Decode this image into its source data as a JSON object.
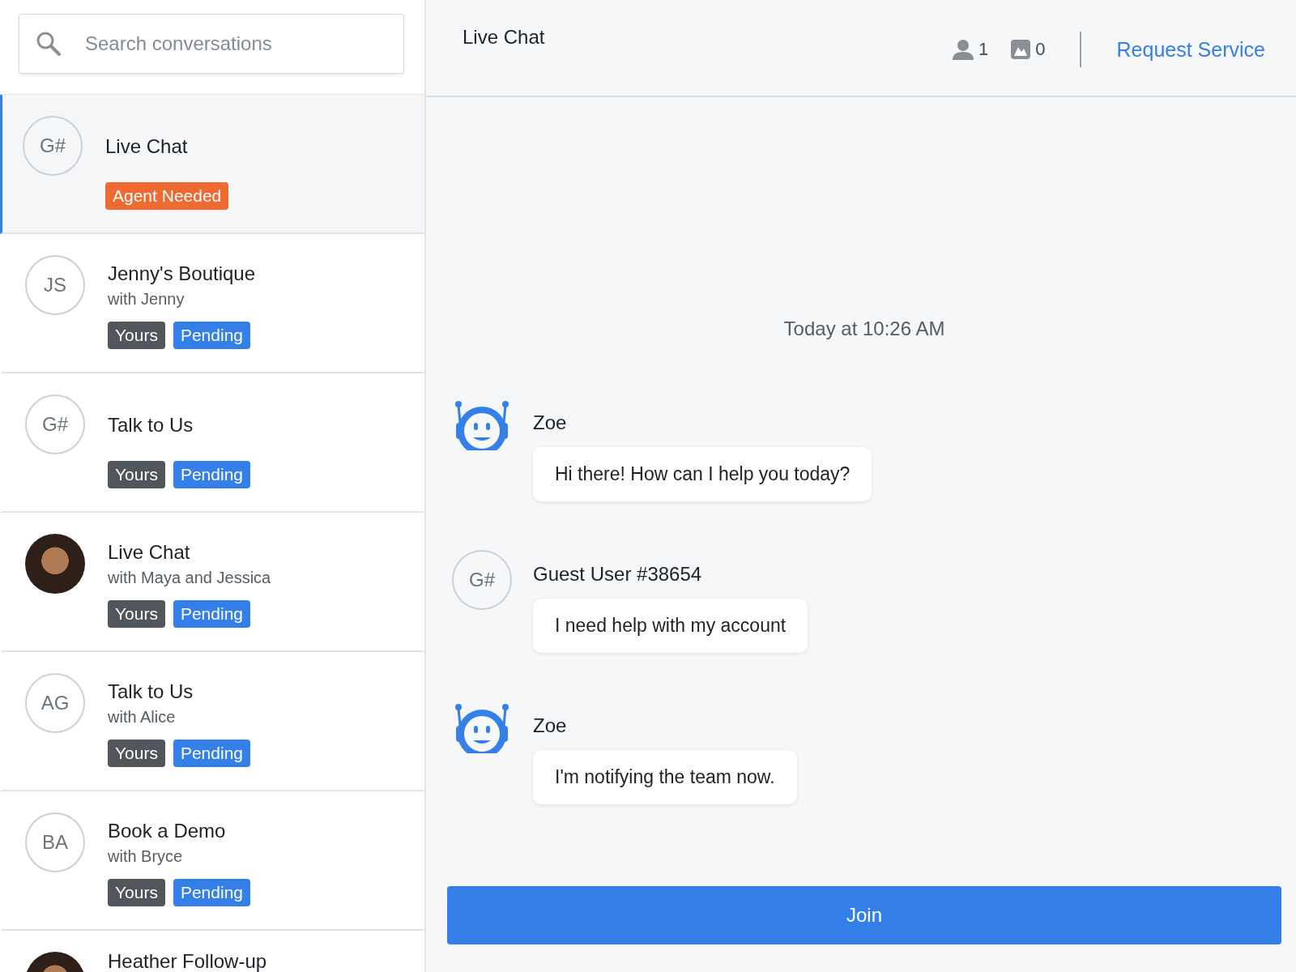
{
  "sidebar": {
    "search": {
      "placeholder": "Search conversations"
    },
    "conversations": [
      {
        "avatar": {
          "kind": "initials",
          "text": "G#"
        },
        "title": "Live Chat",
        "selected": true,
        "tags": [
          {
            "kind": "alert",
            "label": "Agent Needed"
          }
        ]
      },
      {
        "avatar": {
          "kind": "initials",
          "text": "JS"
        },
        "title": "Jenny's Boutique",
        "subtitle": "with Jenny",
        "selected": false,
        "tags": [
          {
            "kind": "owner",
            "label": "Yours"
          },
          {
            "kind": "status",
            "label": "Pending"
          }
        ]
      },
      {
        "avatar": {
          "kind": "initials",
          "text": "G#"
        },
        "title": "Talk to Us",
        "selected": false,
        "tags": [
          {
            "kind": "owner",
            "label": "Yours"
          },
          {
            "kind": "status",
            "label": "Pending"
          }
        ]
      },
      {
        "avatar": {
          "kind": "photo"
        },
        "title": "Live Chat",
        "subtitle": "with Maya and Jessica",
        "selected": false,
        "tags": [
          {
            "kind": "owner",
            "label": "Yours"
          },
          {
            "kind": "status",
            "label": "Pending"
          }
        ]
      },
      {
        "avatar": {
          "kind": "initials",
          "text": "AG"
        },
        "title": "Talk to Us",
        "subtitle": "with Alice",
        "selected": false,
        "tags": [
          {
            "kind": "owner",
            "label": "Yours"
          },
          {
            "kind": "status",
            "label": "Pending"
          }
        ]
      },
      {
        "avatar": {
          "kind": "initials",
          "text": "BA"
        },
        "title": "Book a Demo",
        "subtitle": "with Bryce",
        "selected": false,
        "tags": [
          {
            "kind": "owner",
            "label": "Yours"
          },
          {
            "kind": "status",
            "label": "Pending"
          }
        ]
      },
      {
        "avatar": {
          "kind": "photo"
        },
        "title": "Heather Follow-up",
        "selected": false
      }
    ]
  },
  "chat": {
    "title": "Live Chat",
    "participants": "1",
    "images": "0",
    "action": "Request Service",
    "timestamp": "Today at 10:26 AM",
    "messages": [
      {
        "avatar": {
          "kind": "bot"
        },
        "sender": "Zoe",
        "text": "Hi there! How can I help you today?"
      },
      {
        "avatar": {
          "kind": "initials",
          "text": "G#"
        },
        "sender": "Guest User #38654",
        "text": "I need help with my account"
      },
      {
        "avatar": {
          "kind": "bot"
        },
        "sender": "Zoe",
        "text": "I'm notifying the team now."
      }
    ],
    "button": "Join"
  }
}
